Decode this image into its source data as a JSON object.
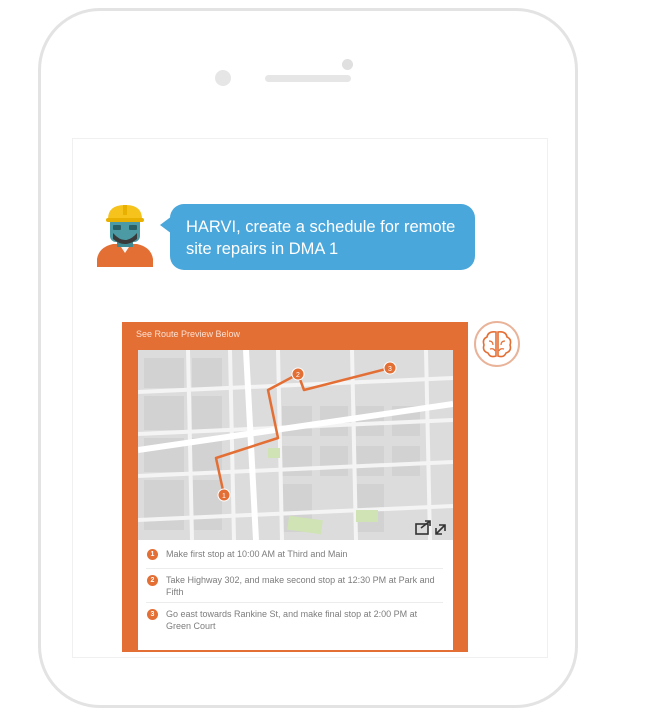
{
  "chat": {
    "user_message": "HARVI, create a schedule for remote site repairs in DMA 1",
    "bot_card": {
      "header": "See Route Preview Below",
      "route_stops": [
        "1",
        "2",
        "3"
      ],
      "steps": [
        {
          "num": "1",
          "text": "Make first stop at 10:00 AM at Third and Main"
        },
        {
          "num": "2",
          "text": "Take Highway 302, and make second stop at 12:30 PM at Park and Fifth"
        },
        {
          "num": "3",
          "text": "Go east towards Rankine St, and make final stop at 2:00 PM at Green Court"
        }
      ]
    }
  },
  "icons": {
    "avatar": "construction-worker-avatar",
    "bot": "brain-icon",
    "share": "share-icon",
    "expand": "expand-icon"
  },
  "colors": {
    "bubble": "#4aa7db",
    "card": "#e46f35",
    "route": "#e46f35",
    "map_bg": "#dcdcdc",
    "park": "#cfe3b4"
  }
}
